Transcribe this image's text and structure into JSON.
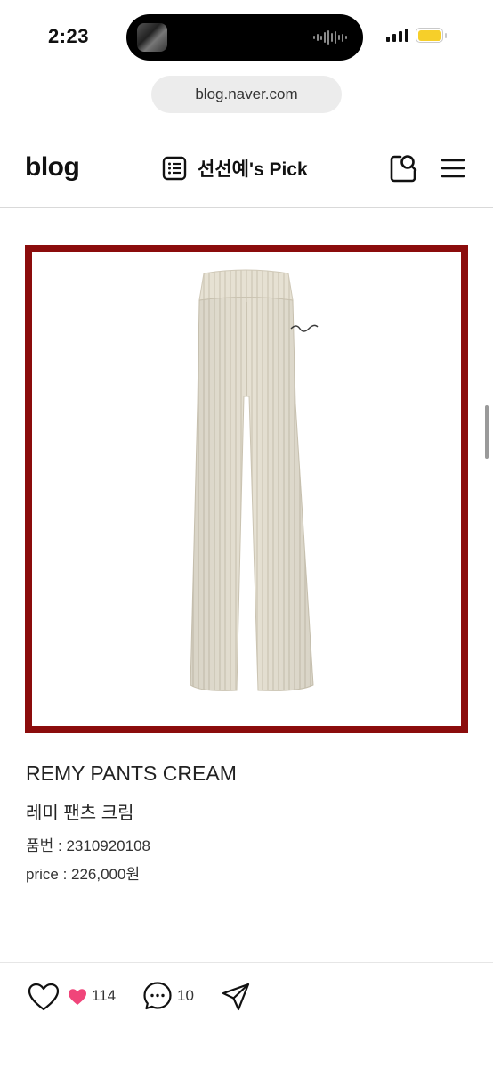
{
  "status_bar": {
    "time": "2:23"
  },
  "browser": {
    "url": "blog.naver.com"
  },
  "header": {
    "logo": "blog",
    "blog_title": "선선예's Pick",
    "icons": [
      "list-icon",
      "search-icon",
      "menu-icon"
    ]
  },
  "product": {
    "image_description_icon": "pants-image",
    "frame_color": "#8b0c0c",
    "name_en": "REMY PANTS CREAM",
    "name_ko": "레미 팬츠 크림",
    "item_number": "품번 : 2310920108",
    "price": "price : 226,000원"
  },
  "footer": {
    "like_count": "114",
    "comment_count": "10",
    "like_color": "#f0457a",
    "icons": [
      "heart-icon",
      "heart-filled-icon",
      "comment-icon",
      "share-icon"
    ]
  }
}
